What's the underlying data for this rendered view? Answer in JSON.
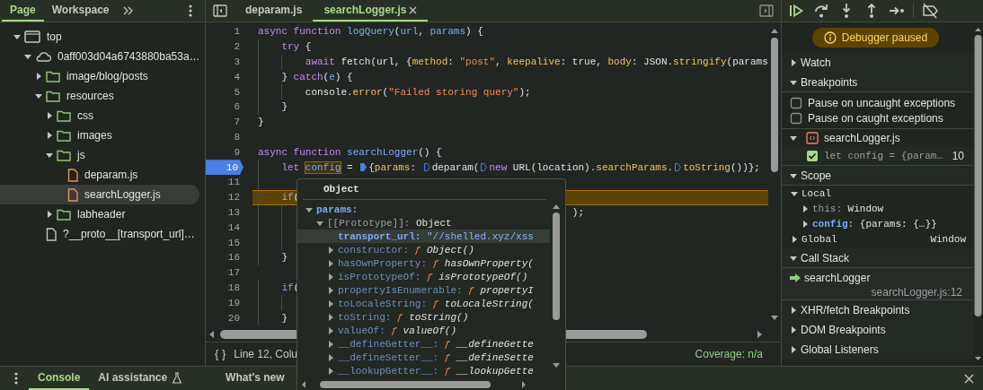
{
  "navigator": {
    "tabs": [
      {
        "label": "Page",
        "selected": true
      },
      {
        "label": "Workspace",
        "selected": false
      }
    ],
    "tree": [
      {
        "label": "top",
        "kind": "frame",
        "expanded": true,
        "selected": false,
        "children": [
          {
            "label": "0aff003d04a6743880ba53a…",
            "kind": "origin",
            "expanded": true,
            "selected": false,
            "children": [
              {
                "label": "image/blog/posts",
                "kind": "folder",
                "expanded": false,
                "selected": false
              },
              {
                "label": "resources",
                "kind": "folder",
                "expanded": true,
                "selected": false,
                "children": [
                  {
                    "label": "css",
                    "kind": "folder",
                    "expanded": false,
                    "selected": false
                  },
                  {
                    "label": "images",
                    "kind": "folder",
                    "expanded": false,
                    "selected": false
                  },
                  {
                    "label": "js",
                    "kind": "folder",
                    "expanded": true,
                    "selected": false,
                    "children": [
                      {
                        "label": "deparam.js",
                        "kind": "script",
                        "selected": false
                      },
                      {
                        "label": "searchLogger.js",
                        "kind": "script",
                        "selected": true
                      }
                    ]
                  },
                  {
                    "label": "labheader",
                    "kind": "folder",
                    "expanded": false,
                    "selected": false
                  }
                ]
              },
              {
                "label": "?__proto__[transport_url]…",
                "kind": "document",
                "selected": false
              }
            ]
          }
        ]
      }
    ]
  },
  "editor": {
    "tabs": [
      {
        "label": "deparam.js",
        "selected": false,
        "closable": false
      },
      {
        "label": "searchLogger.js",
        "selected": true,
        "closable": true
      }
    ],
    "lines": [
      {
        "number": "1",
        "breakpoint": false,
        "paused": false,
        "tokens": [
          {
            "kind": "keyword",
            "text": "async function "
          },
          {
            "kind": "def",
            "text": "logQuery"
          },
          {
            "kind": "plain",
            "text": "("
          },
          {
            "kind": "def",
            "text": "url"
          },
          {
            "kind": "plain",
            "text": ", "
          },
          {
            "kind": "def",
            "text": "params"
          },
          {
            "kind": "plain",
            "text": ") {"
          }
        ]
      },
      {
        "number": "2",
        "breakpoint": false,
        "paused": false,
        "tokens": [
          {
            "kind": "indent"
          },
          {
            "kind": "keyword",
            "text": "try"
          },
          {
            "kind": "plain",
            "text": " {"
          }
        ]
      },
      {
        "number": "3",
        "breakpoint": false,
        "paused": false,
        "tokens": [
          {
            "kind": "indent"
          },
          {
            "kind": "indent"
          },
          {
            "kind": "keyword",
            "text": "await"
          },
          {
            "kind": "plain",
            "text": " fetch(url, {"
          },
          {
            "kind": "prop",
            "text": "method"
          },
          {
            "kind": "plain",
            "text": ": "
          },
          {
            "kind": "string",
            "text": "\"post\""
          },
          {
            "kind": "plain",
            "text": ", "
          },
          {
            "kind": "prop",
            "text": "keepalive"
          },
          {
            "kind": "plain",
            "text": ": true, "
          },
          {
            "kind": "prop",
            "text": "body"
          },
          {
            "kind": "plain",
            "text": ": JSON."
          },
          {
            "kind": "prop",
            "text": "stringify"
          },
          {
            "kind": "plain",
            "text": "(params"
          }
        ]
      },
      {
        "number": "4",
        "breakpoint": false,
        "paused": false,
        "tokens": [
          {
            "kind": "indent"
          },
          {
            "kind": "plain",
            "text": "} "
          },
          {
            "kind": "keyword",
            "text": "catch"
          },
          {
            "kind": "plain",
            "text": "("
          },
          {
            "kind": "def",
            "text": "e"
          },
          {
            "kind": "plain",
            "text": ") {"
          }
        ]
      },
      {
        "number": "5",
        "breakpoint": false,
        "paused": false,
        "tokens": [
          {
            "kind": "indent"
          },
          {
            "kind": "indent"
          },
          {
            "kind": "plain",
            "text": "console."
          },
          {
            "kind": "prop",
            "text": "error"
          },
          {
            "kind": "plain",
            "text": "("
          },
          {
            "kind": "string",
            "text": "\"Failed storing query\""
          },
          {
            "kind": "plain",
            "text": ");"
          }
        ]
      },
      {
        "number": "6",
        "breakpoint": false,
        "paused": false,
        "tokens": [
          {
            "kind": "indent"
          },
          {
            "kind": "plain",
            "text": "}"
          }
        ]
      },
      {
        "number": "7",
        "breakpoint": false,
        "paused": false,
        "tokens": [
          {
            "kind": "plain",
            "text": "}"
          }
        ]
      },
      {
        "number": "8",
        "breakpoint": false,
        "paused": false
      },
      {
        "number": "9",
        "breakpoint": false,
        "paused": false,
        "tokens": [
          {
            "kind": "keyword",
            "text": "async function "
          },
          {
            "kind": "def",
            "text": "searchLogger"
          },
          {
            "kind": "plain",
            "text": "() {"
          }
        ]
      },
      {
        "number": "10",
        "breakpoint": true,
        "paused": false,
        "tokens": [
          {
            "kind": "indent"
          },
          {
            "kind": "keyword",
            "text": "let "
          },
          {
            "kind": "hover",
            "text": "config"
          },
          {
            "kind": "plain",
            "text": " = "
          },
          {
            "kind": "marker",
            "on": true
          },
          {
            "kind": "plain",
            "text": "{"
          },
          {
            "kind": "prop",
            "text": "params"
          },
          {
            "kind": "plain",
            "text": ": "
          },
          {
            "kind": "marker",
            "on": false
          },
          {
            "kind": "plain",
            "text": "deparam("
          },
          {
            "kind": "marker",
            "on": false
          },
          {
            "kind": "keyword",
            "text": "new"
          },
          {
            "kind": "plain",
            "text": " URL(location)."
          },
          {
            "kind": "prop",
            "text": "searchParams"
          },
          {
            "kind": "plain",
            "text": "."
          },
          {
            "kind": "marker",
            "on": false
          },
          {
            "kind": "prop",
            "text": "toString"
          },
          {
            "kind": "plain",
            "text": "())};"
          }
        ]
      },
      {
        "number": "11",
        "breakpoint": false,
        "paused": false,
        "tokens": [
          {
            "kind": "indent"
          }
        ]
      },
      {
        "number": "12",
        "breakpoint": false,
        "paused": true,
        "tokens": [
          {
            "kind": "indent"
          },
          {
            "kind": "keyword",
            "text": "if"
          },
          {
            "kind": "plain",
            "text": "("
          }
        ]
      },
      {
        "number": "13",
        "breakpoint": false,
        "paused": false,
        "tokens": [
          {
            "kind": "indent"
          },
          {
            "kind": "indent"
          },
          {
            "kind": "tail",
            "text": ");"
          }
        ]
      },
      {
        "number": "14",
        "breakpoint": false,
        "paused": false,
        "tokens": [
          {
            "kind": "indent"
          },
          {
            "kind": "indent"
          }
        ]
      },
      {
        "number": "15",
        "breakpoint": false,
        "paused": false,
        "tokens": [
          {
            "kind": "indent"
          },
          {
            "kind": "indent"
          }
        ]
      },
      {
        "number": "16",
        "breakpoint": false,
        "paused": false,
        "tokens": [
          {
            "kind": "indent"
          },
          {
            "kind": "plain",
            "text": "}"
          }
        ]
      },
      {
        "number": "17",
        "breakpoint": false,
        "paused": false
      },
      {
        "number": "18",
        "breakpoint": false,
        "paused": false,
        "tokens": [
          {
            "kind": "indent"
          },
          {
            "kind": "keyword",
            "text": "if"
          },
          {
            "kind": "plain",
            "text": "("
          }
        ]
      },
      {
        "number": "19",
        "breakpoint": false,
        "paused": false,
        "tokens": [
          {
            "kind": "indent"
          },
          {
            "kind": "indent"
          }
        ]
      },
      {
        "number": "20",
        "breakpoint": false,
        "paused": false,
        "tokens": [
          {
            "kind": "indent"
          },
          {
            "kind": "plain",
            "text": "}"
          }
        ]
      }
    ],
    "status": {
      "format": "{ }",
      "position": "Line 12, Colu",
      "coverage": "Coverage: n/a"
    }
  },
  "popup": {
    "title": "Object",
    "rows": [
      {
        "label": "params:",
        "kind": "object",
        "expanded": true,
        "selected": false,
        "children": [
          {
            "label": "[[Prototype]]:",
            "value": "Object",
            "kind": "prototype",
            "expanded": true,
            "selected": false,
            "children": [
              {
                "label": "transport_url:",
                "kind": "string",
                "value": "\"//shelled.xyz/xss",
                "selected": true
              },
              {
                "label": "constructor:",
                "kind": "function",
                "fn": "ƒ",
                "value": "Object()",
                "expanded": false,
                "selected": false
              },
              {
                "label": "hasOwnProperty:",
                "kind": "function",
                "fn": "ƒ",
                "value": "hasOwnProperty(",
                "expanded": false,
                "selected": false
              },
              {
                "label": "isPrototypeOf:",
                "kind": "function",
                "fn": "ƒ",
                "value": "isPrototypeOf()",
                "expanded": false,
                "selected": false
              },
              {
                "label": "propertyIsEnumerable:",
                "kind": "function",
                "fn": "ƒ",
                "value": "propertyI",
                "expanded": false,
                "selected": false
              },
              {
                "label": "toLocaleString:",
                "kind": "function",
                "fn": "ƒ",
                "value": "toLocaleString(",
                "expanded": false,
                "selected": false
              },
              {
                "label": "toString:",
                "kind": "function",
                "fn": "ƒ",
                "value": "toString()",
                "expanded": false,
                "selected": false
              },
              {
                "label": "valueOf:",
                "kind": "function",
                "fn": "ƒ",
                "value": "valueOf()",
                "expanded": false,
                "selected": false
              },
              {
                "label": "__defineGetter__:",
                "kind": "function",
                "fn": "ƒ",
                "value": "__defineGette",
                "expanded": false,
                "selected": false
              },
              {
                "label": "__defineSetter__:",
                "kind": "function",
                "fn": "ƒ",
                "value": "__defineSette",
                "expanded": false,
                "selected": false
              },
              {
                "label": "__lookupGetter__:",
                "kind": "function",
                "fn": "ƒ",
                "value": "__lookupGette",
                "expanded": false,
                "selected": false
              }
            ]
          }
        ]
      }
    ]
  },
  "debugger": {
    "status": "Debugger paused",
    "sections": [
      {
        "kind": "plain",
        "title": "Watch",
        "expanded": false
      },
      {
        "kind": "breakpoints",
        "title": "Breakpoints",
        "expanded": true,
        "options": [
          {
            "label": "Pause on uncaught exceptions",
            "checked": false
          },
          {
            "label": "Pause on caught exceptions",
            "checked": false
          }
        ],
        "files": [
          {
            "name": "searchLogger.js",
            "expanded": true,
            "breakpoints": [
              {
                "code": "let config = {param…",
                "line": "10",
                "checked": true
              }
            ]
          }
        ]
      },
      {
        "kind": "scope",
        "title": "Scope",
        "expanded": true,
        "scopes": [
          {
            "name": "Local",
            "expanded": true,
            "variables": [
              {
                "name": "this:",
                "value": "Window",
                "kind": "receiver",
                "expanded": false
              },
              {
                "name": "config:",
                "value": "{params: {…}}",
                "kind": "own",
                "expanded": false
              }
            ]
          },
          {
            "name": "Global",
            "expanded": false,
            "value": "Window"
          }
        ]
      },
      {
        "kind": "callstack",
        "title": "Call Stack",
        "expanded": true,
        "frames": [
          {
            "function": "searchLogger",
            "location": "searchLogger.js:12",
            "current": true
          }
        ]
      },
      {
        "kind": "plain",
        "title": "XHR/fetch Breakpoints",
        "expanded": false
      },
      {
        "kind": "plain",
        "title": "DOM Breakpoints",
        "expanded": false
      },
      {
        "kind": "plain",
        "title": "Global Listeners",
        "expanded": false
      }
    ]
  },
  "drawer": {
    "tabs": [
      {
        "label": "Console",
        "selected": true,
        "kind": "standard"
      },
      {
        "label": "AI assistance",
        "selected": false,
        "kind": "experimental"
      },
      {
        "label": "What's new",
        "selected": false,
        "kind": "standard"
      }
    ]
  }
}
